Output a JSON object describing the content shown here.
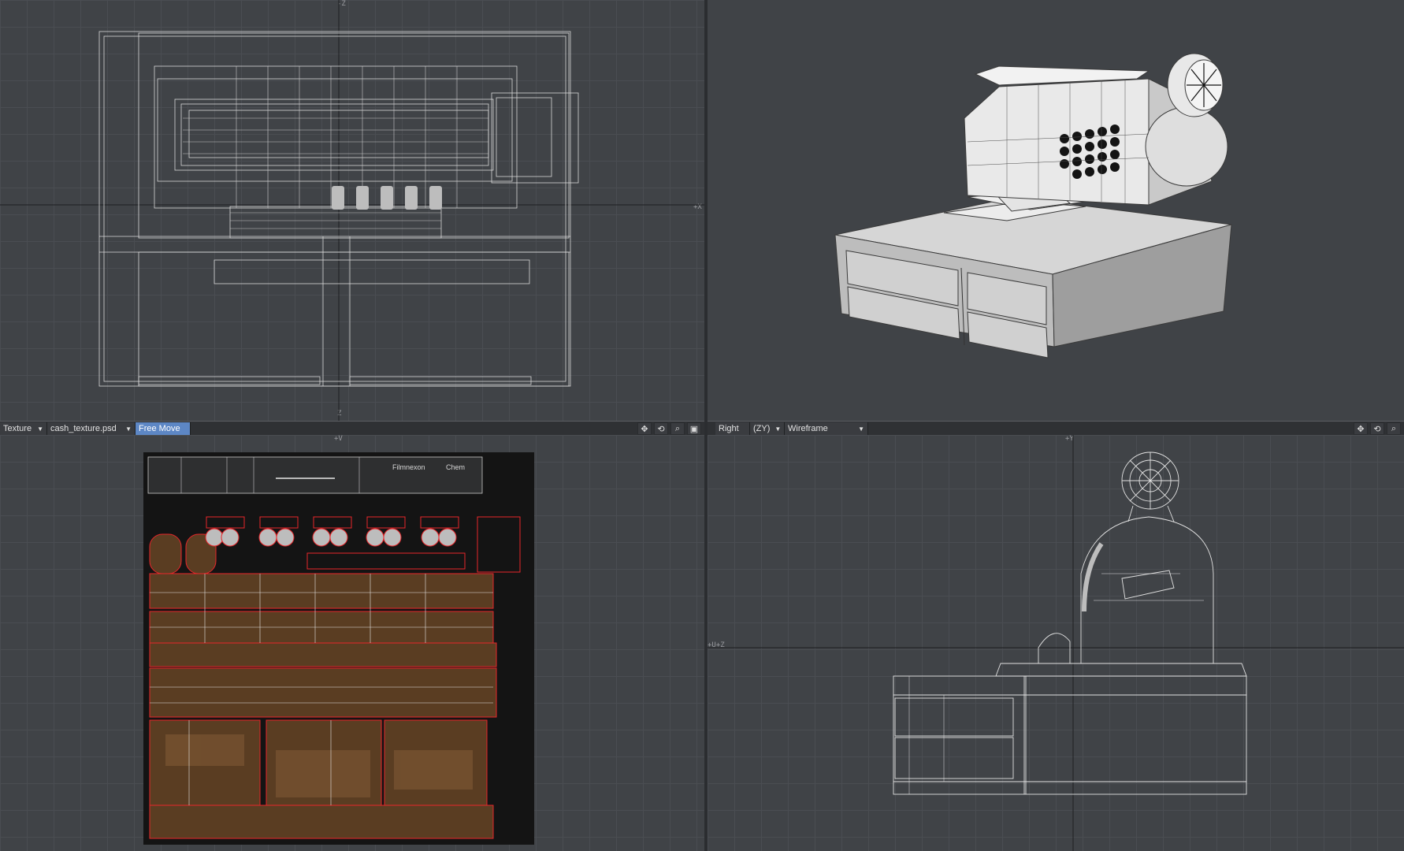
{
  "viewports": {
    "top_left": {
      "axis_top": "-Z",
      "axis_bottom": "Z",
      "axis_right": "+X"
    },
    "top_right": {
      "name": "perspective-view"
    },
    "bottom_left": {
      "axis_top": "+V"
    },
    "bottom_right": {
      "axis_top": "+Y",
      "axis_left": "+U+Z"
    }
  },
  "toolbar_left": {
    "view_mode": "Texture",
    "texture_file": "cash_texture.psd",
    "tool": "Free Move"
  },
  "toolbar_right": {
    "view": "Right",
    "axes": "(ZY)",
    "render_mode": "Wireframe"
  },
  "texture_labels": {
    "label_1": "Filmnexon",
    "label_2": "Chem"
  },
  "icons": [
    "move-icon",
    "rotate-icon",
    "zoom-icon",
    "maximize-icon"
  ],
  "colors": {
    "background": "#404347",
    "grid": "#4a4d52",
    "wire": "#d8d8d8",
    "uv_edges": "#e8262a",
    "accent": "#5d87c5"
  }
}
